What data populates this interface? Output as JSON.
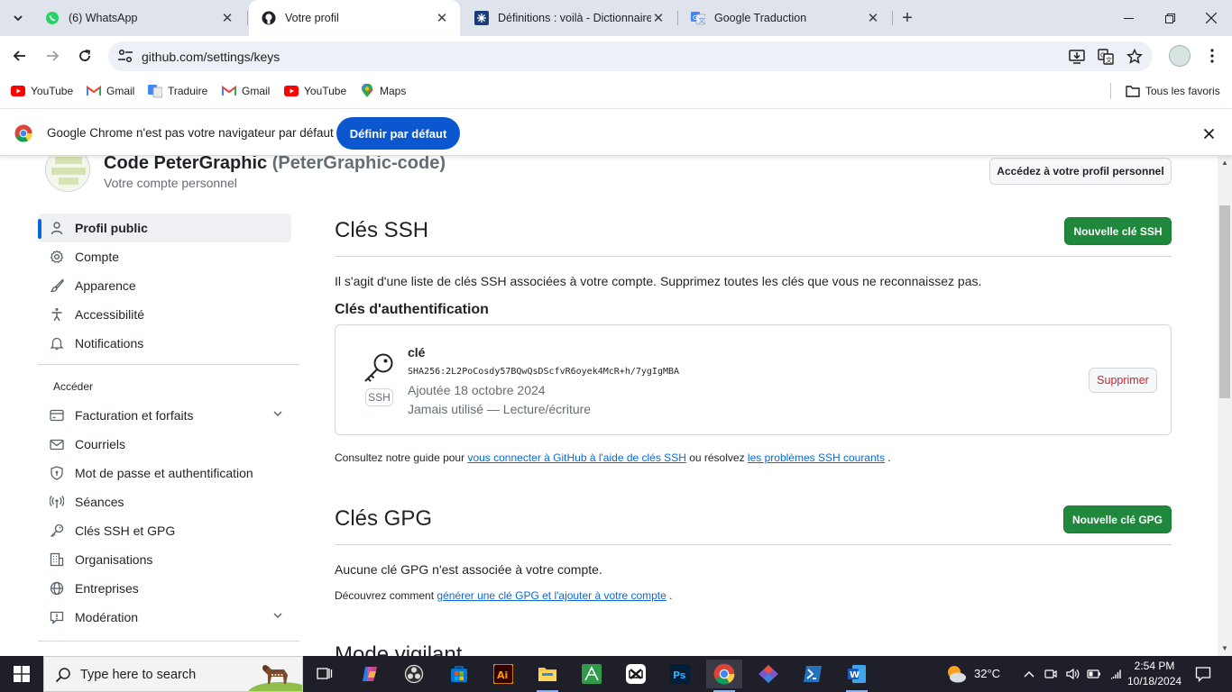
{
  "browser": {
    "tabs": [
      {
        "title": "(6) WhatsApp",
        "icon": "whatsapp-icon"
      },
      {
        "title": "Votre profil",
        "icon": "github-icon",
        "active": true
      },
      {
        "title": "Définitions : voilà - Dictionnaire",
        "icon": "larousse-icon"
      },
      {
        "title": "Google Traduction",
        "icon": "translate-icon"
      }
    ],
    "url": "github.com/settings/keys",
    "bookmarks": [
      {
        "label": "YouTube",
        "icon": "youtube-icon"
      },
      {
        "label": "Gmail",
        "icon": "gmail-icon"
      },
      {
        "label": "Traduire",
        "icon": "translate-icon"
      },
      {
        "label": "Gmail",
        "icon": "gmail-icon"
      },
      {
        "label": "YouTube",
        "icon": "youtube-icon"
      },
      {
        "label": "Maps",
        "icon": "maps-icon"
      }
    ],
    "all_bookmarks": "Tous les favoris",
    "infobar": {
      "message": "Google Chrome n'est pas votre navigateur par défaut",
      "button": "Définir par défaut"
    }
  },
  "account": {
    "display_name": "Code PeterGraphic",
    "login": "(PeterGraphic-code)",
    "subtitle": "Votre compte personnel",
    "profile_button": "Accédez à votre profil personnel"
  },
  "sidebar": {
    "items_top": [
      {
        "label": "Profil public",
        "icon": "person-icon",
        "active": true
      },
      {
        "label": "Compte",
        "icon": "gear-icon"
      },
      {
        "label": "Apparence",
        "icon": "paintbrush-icon"
      },
      {
        "label": "Accessibilité",
        "icon": "accessibility-icon"
      },
      {
        "label": "Notifications",
        "icon": "bell-icon"
      }
    ],
    "heading": "Accéder",
    "items_access": [
      {
        "label": "Facturation et forfaits",
        "icon": "credit-card-icon",
        "expandable": true
      },
      {
        "label": "Courriels",
        "icon": "mail-icon"
      },
      {
        "label": "Mot de passe et authentification",
        "icon": "shield-lock-icon"
      },
      {
        "label": "Séances",
        "icon": "broadcast-icon"
      },
      {
        "label": "Clés SSH et GPG",
        "icon": "key-icon"
      },
      {
        "label": "Organisations",
        "icon": "organization-icon"
      },
      {
        "label": "Entreprises",
        "icon": "globe-icon"
      },
      {
        "label": "Modération",
        "icon": "report-icon",
        "expandable": true
      }
    ]
  },
  "ssh": {
    "title": "Clés SSH",
    "new_button": "Nouvelle clé SSH",
    "description": "Il s'agit d'une liste de clés SSH associées à votre compte. Supprimez toutes les clés que vous ne reconnaissez pas.",
    "auth_heading": "Clés d'authentification",
    "key": {
      "badge": "SSH",
      "title": "clé",
      "fingerprint": "SHA256:2L2PoCosdy57BQwQsDScfvR6oyek4McR+h/7ygIgMBA",
      "added": "Ajoutée 18 octobre 2024",
      "usage": "Jamais utilisé — Lecture/écriture",
      "delete_button": "Supprimer"
    },
    "guide_prefix": "Consultez notre guide pour",
    "guide_link1": "vous connecter à GitHub à l'aide de clés SSH",
    "guide_middle": "ou résolvez",
    "guide_link2": "les problèmes SSH courants",
    "guide_suffix": "."
  },
  "gpg": {
    "title": "Clés GPG",
    "new_button": "Nouvelle clé GPG",
    "empty": "Aucune clé GPG n'est associée à votre compte.",
    "learn_prefix": "Découvrez comment",
    "learn_link": "générer une clé GPG et l'ajouter à votre compte",
    "learn_suffix": "."
  },
  "vigilant": {
    "title": "Mode vigilant"
  },
  "taskbar": {
    "search_placeholder": "Type here to search",
    "weather": "32°C",
    "time": "2:54 PM",
    "date": "10/18/2024"
  },
  "colors": {
    "accent_blue": "#0969da",
    "github_green": "#1f883d",
    "danger_red": "#cf222e",
    "chrome_blue": "#0b57d0"
  }
}
